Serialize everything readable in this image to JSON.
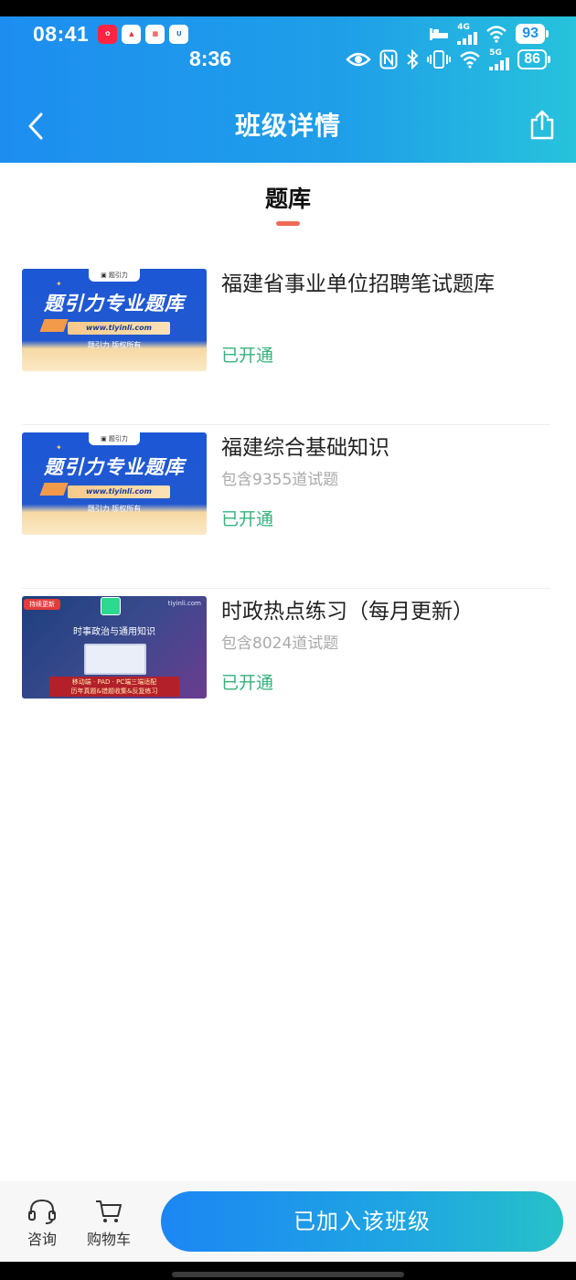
{
  "status_bar_top": {
    "time": "08:41",
    "network": "4G",
    "battery": "93",
    "icons": [
      "app-xiaohongshu-icon",
      "app-red-a-icon",
      "app-qr-icon",
      "app-blue-u-icon",
      "bed-icon",
      "signal-icon",
      "wifi-icon",
      "battery-icon"
    ]
  },
  "status_bar_inner": {
    "time": "8:36",
    "network": "5G",
    "battery": "86",
    "icons": [
      "eye-icon",
      "nfc-icon",
      "bluetooth-icon",
      "vibrate-icon",
      "wifi-icon",
      "signal-icon",
      "battery-icon"
    ]
  },
  "nav": {
    "title": "班级详情",
    "back_icon": "chevron-left-icon",
    "share_icon": "share-icon"
  },
  "tab": {
    "label": "题库"
  },
  "items": [
    {
      "thumb_type": "blue",
      "thumb_title": "题引力专业题库",
      "thumb_url": "www.tiyinli.com",
      "thumb_copy": "题引力 版权所有",
      "title": "福建省事业单位招聘笔试题库",
      "count": "",
      "status": "已开通"
    },
    {
      "thumb_type": "blue",
      "thumb_title": "题引力专业题库",
      "thumb_url": "www.tiyinli.com",
      "thumb_copy": "题引力 版权所有",
      "title": "福建综合基础知识",
      "count": "包含9355道试题",
      "status": "已开通"
    },
    {
      "thumb_type": "dark",
      "thumb_tag": "持续更新",
      "thumb_site": "tiyinli.com",
      "thumb_subtitle": "时事政治与通用知识",
      "thumb_banner_1": "移动端 · PAD · PC端三端适配",
      "thumb_banner_2": "历年真题&错题收集&反复练习",
      "title": "时政热点练习（每月更新）",
      "count": "包含8024道试题",
      "status": "已开通"
    }
  ],
  "bottom": {
    "consult_label": "咨询",
    "consult_icon": "headset-icon",
    "cart_label": "购物车",
    "cart_icon": "cart-icon",
    "join_label": "已加入该班级"
  },
  "colors": {
    "header_gradient_start": "#1d8ef0",
    "header_gradient_end": "#27c2dc",
    "status_green": "#34b27d",
    "tab_indicator": "#ee6a55"
  }
}
